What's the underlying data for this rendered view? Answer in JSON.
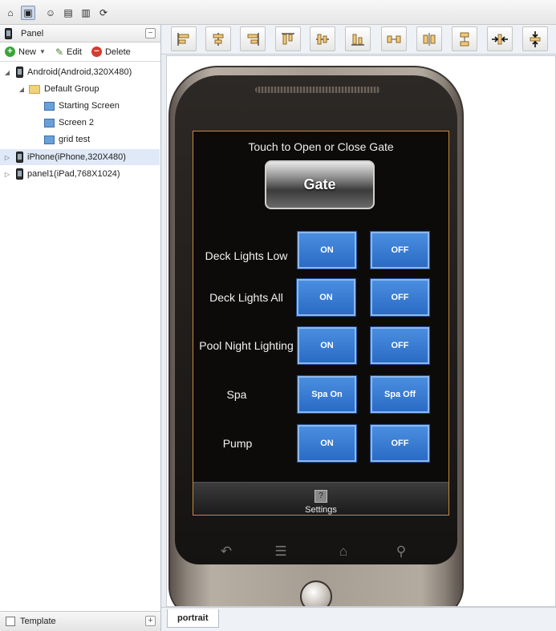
{
  "toolbar": {
    "icons": [
      "home-icon",
      "project-icon",
      "user-icon",
      "save-icon",
      "library-icon",
      "refresh-icon"
    ]
  },
  "panel": {
    "title": "Panel",
    "actions": {
      "new": "New",
      "edit": "Edit",
      "delete": "Delete"
    },
    "tree": [
      {
        "label": "Android(Android,320X480)",
        "level": 0,
        "expanded": true,
        "icon": "phone-icon"
      },
      {
        "label": "Default Group",
        "level": 1,
        "expanded": true,
        "icon": "folder-icon"
      },
      {
        "label": "Starting Screen",
        "level": 2,
        "icon": "screen-icon"
      },
      {
        "label": "Screen 2",
        "level": 2,
        "icon": "screen-icon"
      },
      {
        "label": "grid test",
        "level": 2,
        "icon": "screen-icon"
      },
      {
        "label": "iPhone(iPhone,320X480)",
        "level": 0,
        "expanded": false,
        "selected": true,
        "icon": "phone-icon"
      },
      {
        "label": "panel1(iPad,768X1024)",
        "level": 0,
        "expanded": false,
        "icon": "phone-icon"
      }
    ],
    "footer": "Template"
  },
  "align_tools": [
    "align-left",
    "align-center-horizontal",
    "align-right",
    "align-top",
    "align-middle",
    "align-bottom",
    "distribute-horizontal",
    "distribute-center",
    "distribute-vertical",
    "compress-horizontal",
    "compress-vertical"
  ],
  "device_screen": {
    "gate_title": "Touch to Open or Close Gate",
    "gate_button": "Gate",
    "rows": [
      {
        "label": "Deck Lights Low",
        "on": "ON",
        "off": "OFF"
      },
      {
        "label": "Deck Lights All",
        "on": "ON",
        "off": "OFF"
      },
      {
        "label": "Pool Night Lighting",
        "on": "ON",
        "off": "OFF"
      },
      {
        "label": "Spa",
        "on": "Spa On",
        "off": "Spa Off"
      },
      {
        "label": "Pump",
        "on": "ON",
        "off": "OFF"
      }
    ],
    "settings_label": "Settings",
    "settings_icon": "?"
  },
  "tabs": {
    "portrait": "portrait"
  },
  "colors": {
    "accent_blue": "#2a6bc4",
    "screen_border": "#c78a3e",
    "selected_row": "#dfe9f7"
  }
}
